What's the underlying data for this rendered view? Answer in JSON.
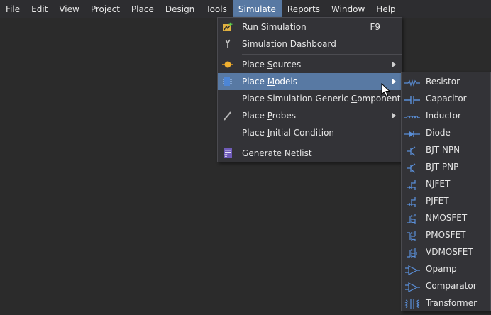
{
  "menubar": {
    "items": [
      {
        "pre": "",
        "u": "F",
        "post": "ile"
      },
      {
        "pre": "",
        "u": "E",
        "post": "dit"
      },
      {
        "pre": "",
        "u": "V",
        "post": "iew"
      },
      {
        "pre": "Proje",
        "u": "c",
        "post": "t"
      },
      {
        "pre": "",
        "u": "P",
        "post": "lace"
      },
      {
        "pre": "",
        "u": "D",
        "post": "esign"
      },
      {
        "pre": "",
        "u": "T",
        "post": "ools"
      },
      {
        "pre": "",
        "u": "S",
        "post": "imulate"
      },
      {
        "pre": "",
        "u": "R",
        "post": "eports"
      },
      {
        "pre": "",
        "u": "W",
        "post": "indow"
      },
      {
        "pre": "",
        "u": "H",
        "post": "elp"
      }
    ]
  },
  "simulate_menu": {
    "run": {
      "pre": "",
      "u": "R",
      "post": "un Simulation",
      "shortcut": "F9"
    },
    "dashboard": {
      "pre": "Simulation ",
      "u": "D",
      "post": "ashboard"
    },
    "sources": {
      "pre": "Place ",
      "u": "S",
      "post": "ources"
    },
    "models": {
      "pre": "Place ",
      "u": "M",
      "post": "odels"
    },
    "generic": {
      "pre": "Place Simulation Generic ",
      "u": "C",
      "post": "omponent"
    },
    "probes": {
      "pre": "Place ",
      "u": "P",
      "post": "robes"
    },
    "initial": {
      "pre": "Place ",
      "u": "I",
      "post": "nitial Condition"
    },
    "netlist": {
      "pre": "",
      "u": "G",
      "post": "enerate Netlist"
    }
  },
  "models_menu": {
    "items": [
      "Resistor",
      "Capacitor",
      "Inductor",
      "Diode",
      "BJT NPN",
      "BJT PNP",
      "NJFET",
      "PJFET",
      "NMOSFET",
      "PMOSFET",
      "VDMOSFET",
      "Opamp",
      "Comparator",
      "Transformer"
    ]
  },
  "colors": {
    "accent": "#5879a3",
    "icon_blue": "#5a8fd8"
  }
}
